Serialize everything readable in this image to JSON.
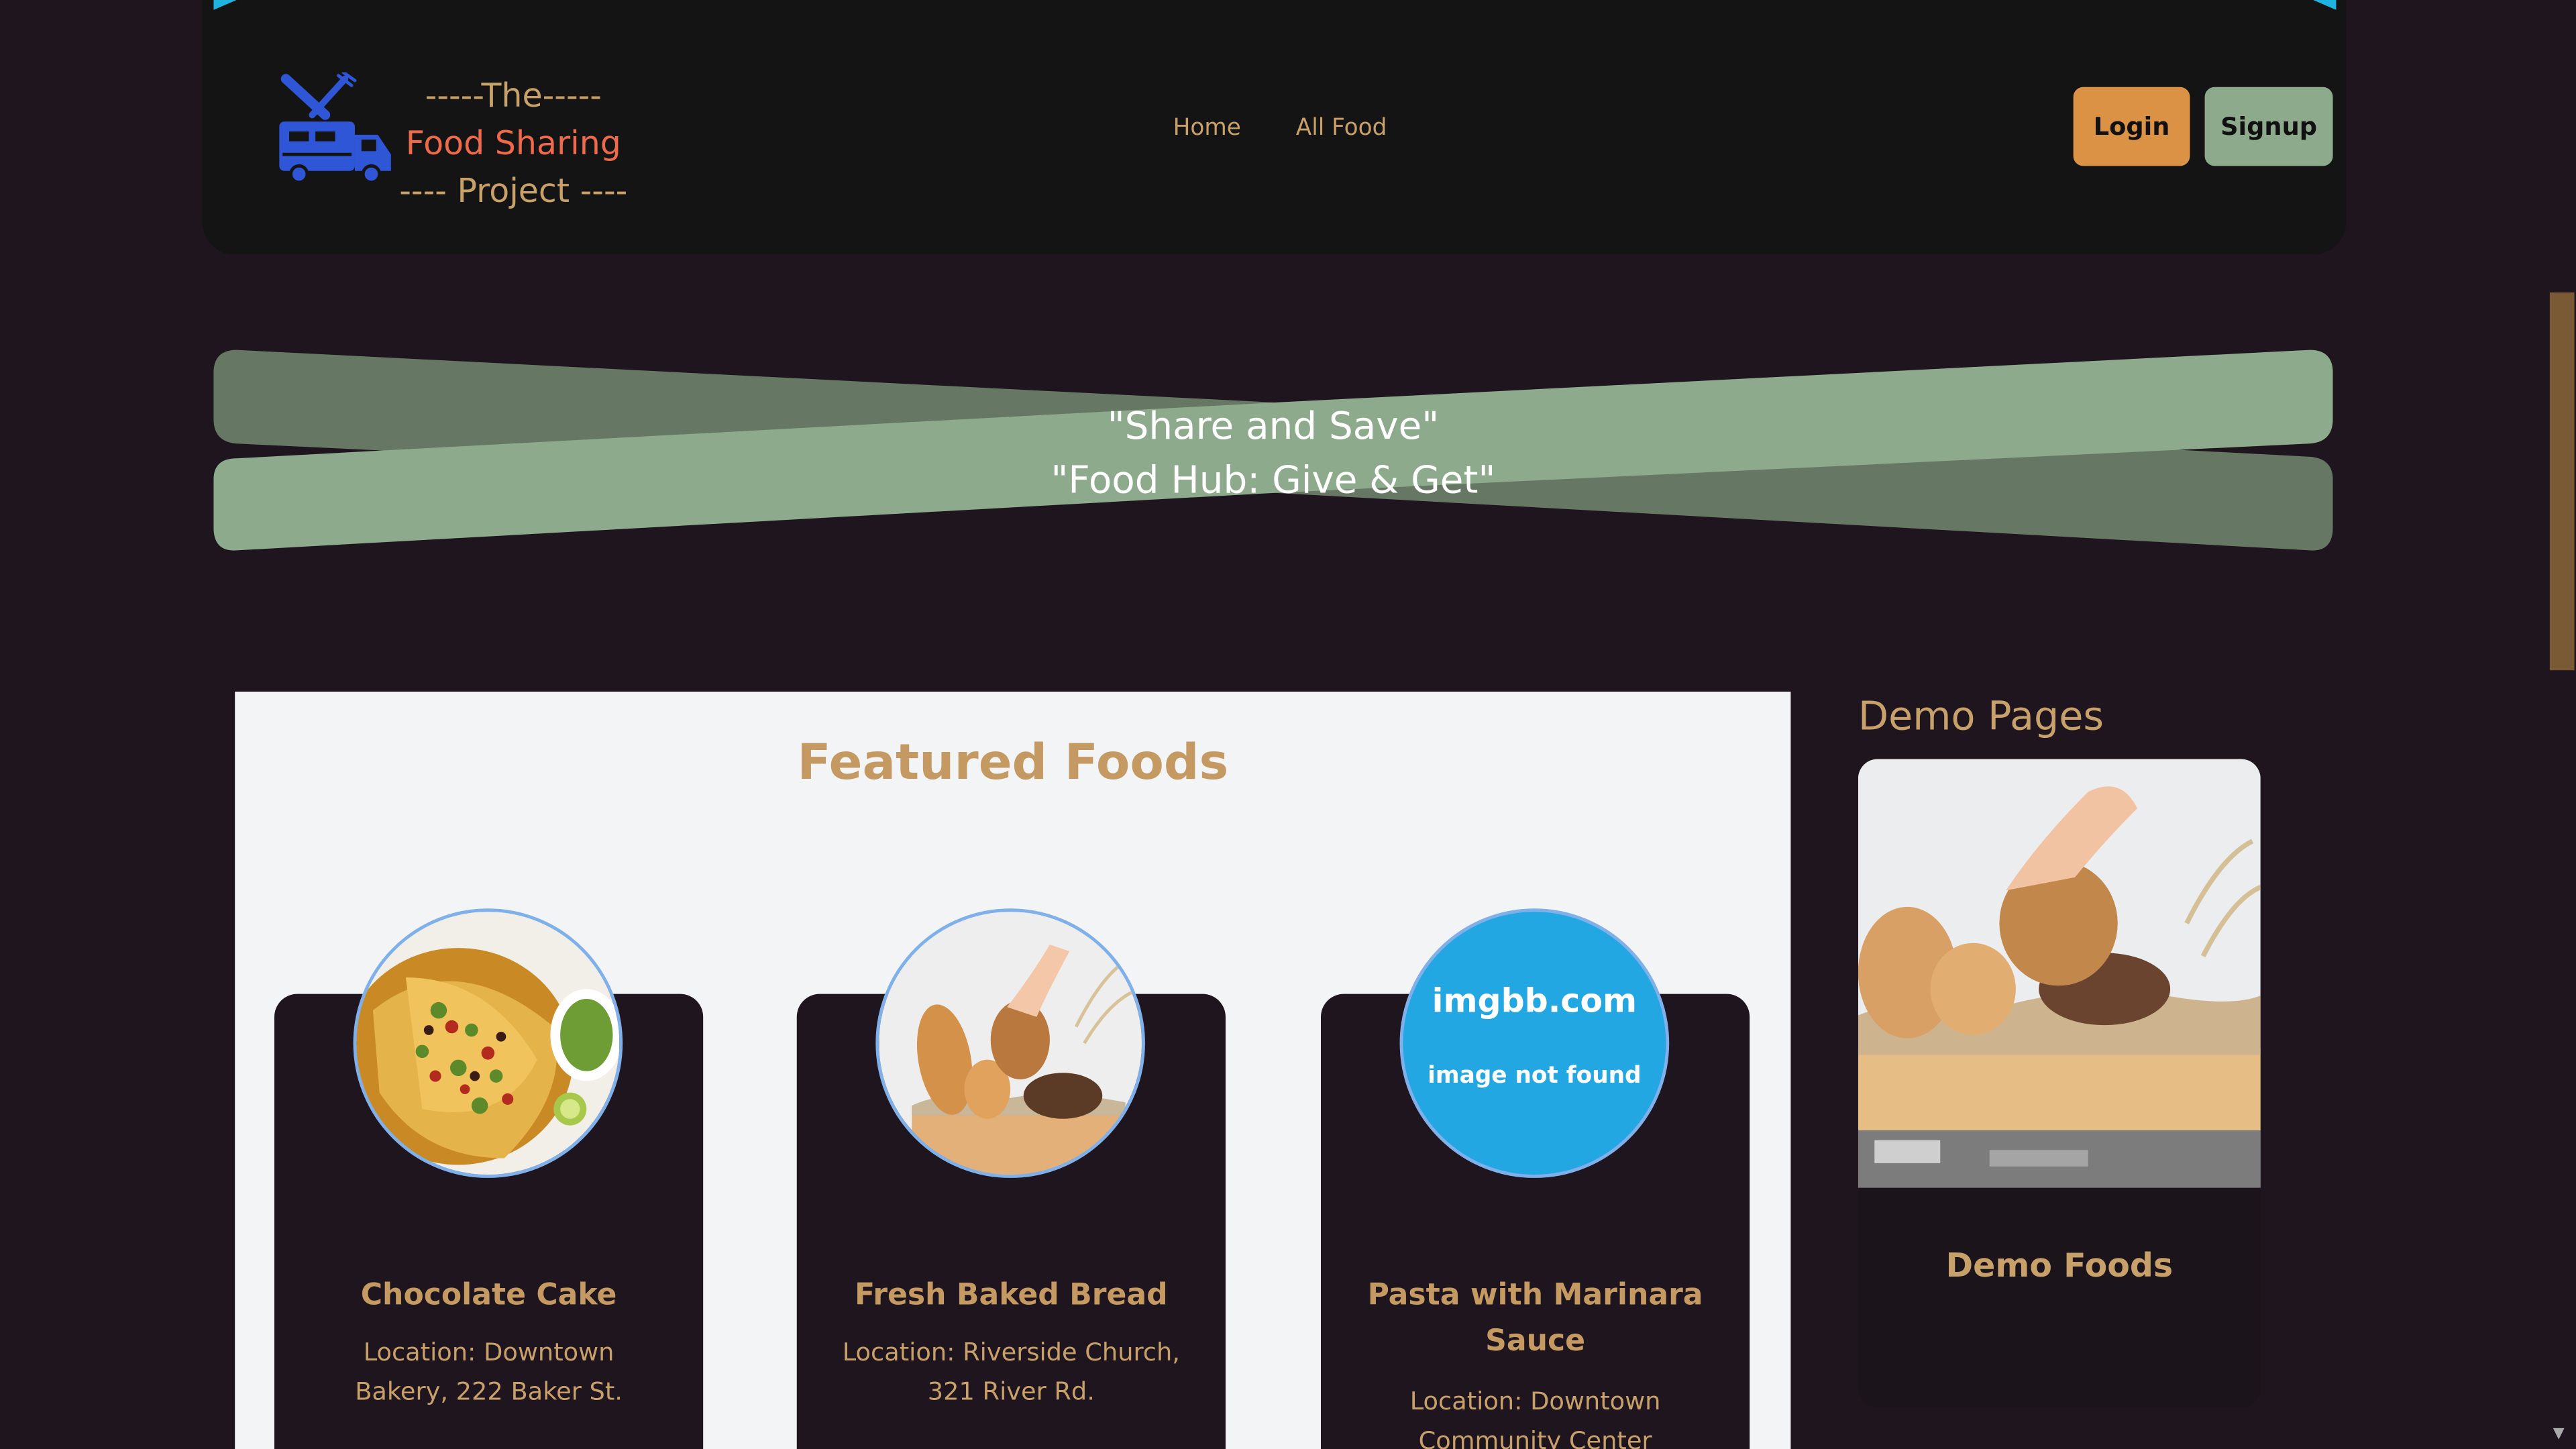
{
  "logo": {
    "line1": "-----The-----",
    "line2": "Food Sharing",
    "line3": "---- Project ----",
    "icon": "food-truck-icon"
  },
  "nav": {
    "home": "Home",
    "all_food": "All Food"
  },
  "auth": {
    "login": "Login",
    "signup": "Signup"
  },
  "banner": {
    "line1": "\"Share and Save\"",
    "line2": "\"Food Hub: Give & Get\""
  },
  "featured": {
    "title": "Featured Foods",
    "items": [
      {
        "name": "Chocolate Cake",
        "location": "Location: Downtown Bakery, 222 Baker St."
      },
      {
        "name": "Fresh Baked Bread",
        "location": "Location: Riverside Church, 321 River Rd."
      },
      {
        "name": "Pasta with Marinara Sauce",
        "location": "Location: Downtown Community Center"
      }
    ],
    "placeholder": {
      "site": "imgbb.com",
      "message": "image not found"
    }
  },
  "demo": {
    "title": "Demo Pages",
    "card_label": "Demo Foods"
  },
  "colors": {
    "background": "#1f151e",
    "gold": "#c49a62",
    "orange": "#dc9244",
    "sage": "#8eaa8d"
  }
}
